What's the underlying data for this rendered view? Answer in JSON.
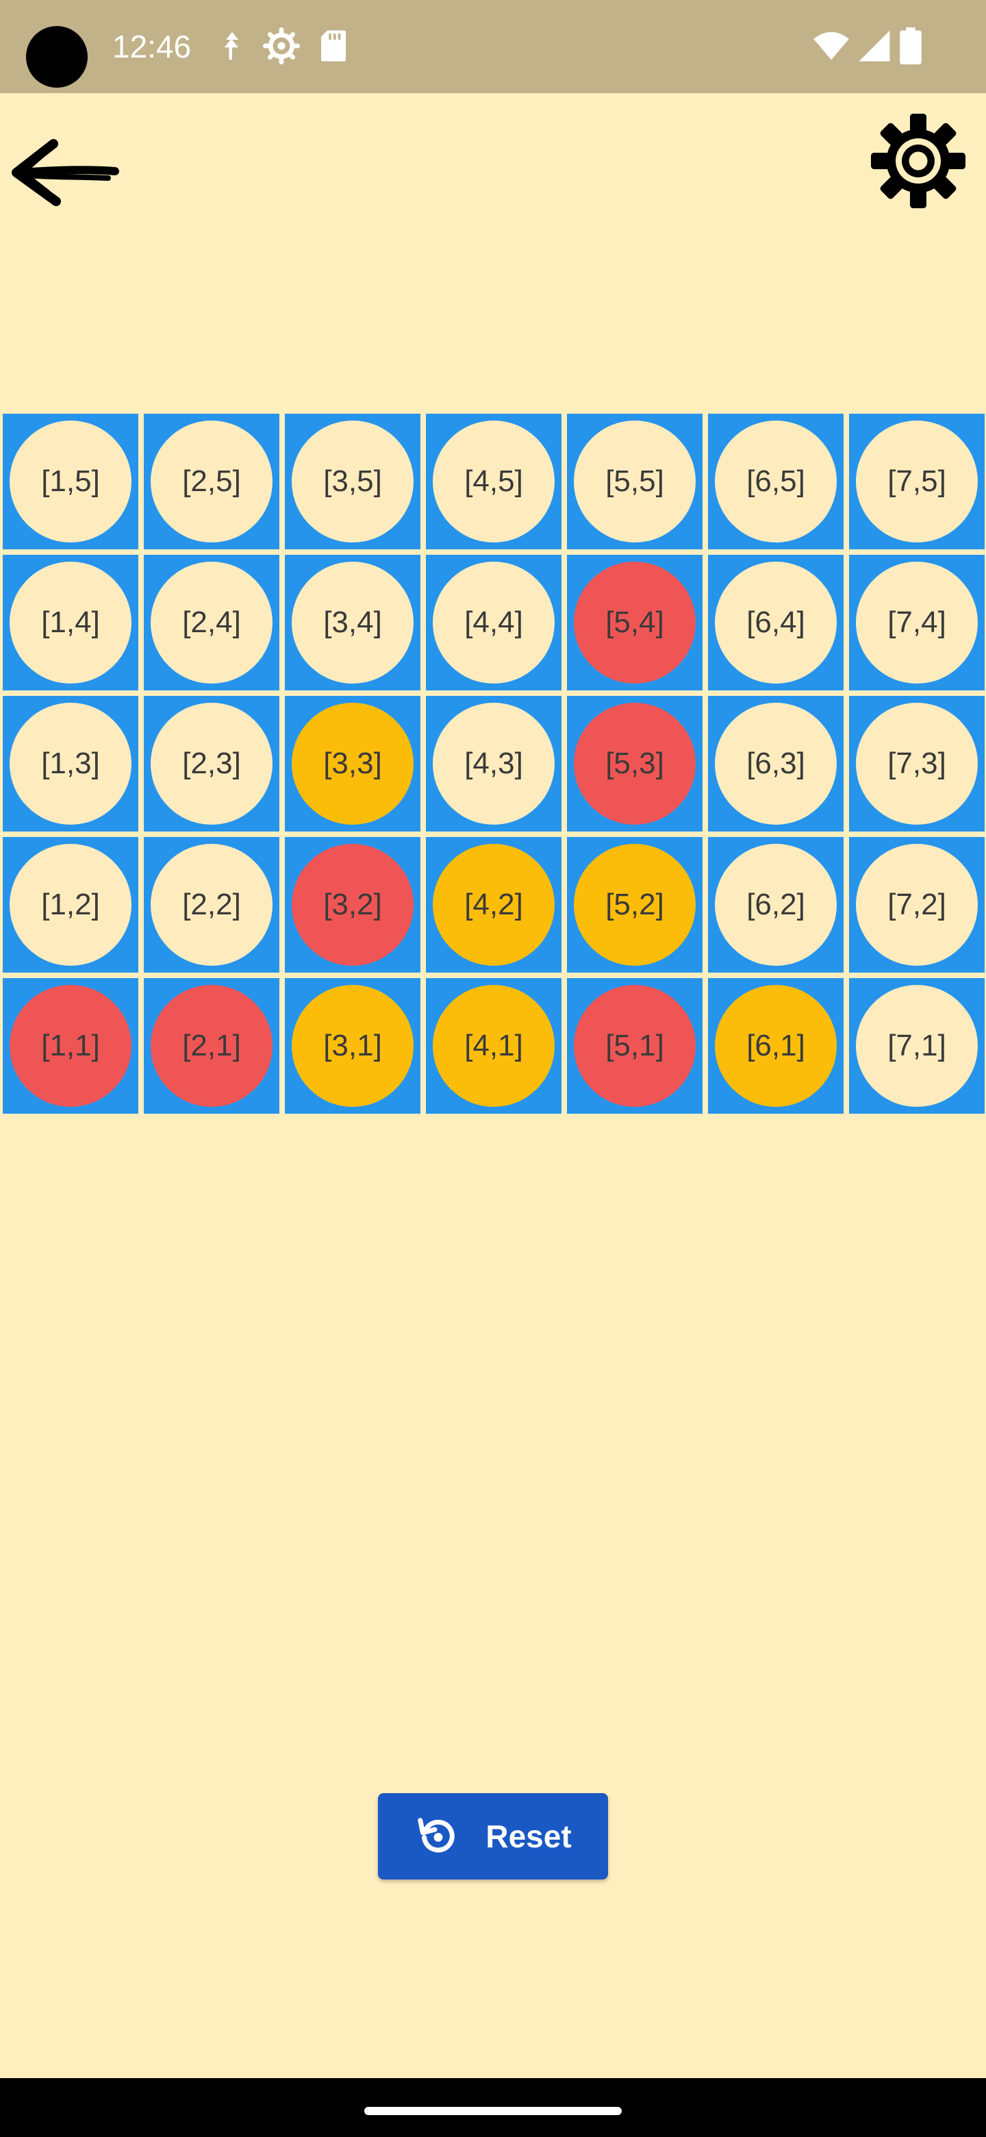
{
  "status_bar": {
    "time": "12:46",
    "left_icons": [
      "data-saver-icon",
      "settings-cog-icon",
      "sd-card-icon"
    ],
    "right_icons": [
      "wifi-icon",
      "cell-signal-icon",
      "battery-icon"
    ]
  },
  "header": {
    "back_icon": "back-arrow-icon",
    "settings_icon": "gear-icon"
  },
  "colors": {
    "background": "#ffefbf",
    "board": "#2694eb",
    "empty": "#ffecbe",
    "red": "#f05555",
    "yellow": "#fbbd0a",
    "reset_button": "#1a58c4"
  },
  "board": {
    "columns": 7,
    "rows": 5,
    "cells": [
      {
        "label": "[1,5]",
        "state": "empty"
      },
      {
        "label": "[2,5]",
        "state": "empty"
      },
      {
        "label": "[3,5]",
        "state": "empty"
      },
      {
        "label": "[4,5]",
        "state": "empty"
      },
      {
        "label": "[5,5]",
        "state": "empty"
      },
      {
        "label": "[6,5]",
        "state": "empty"
      },
      {
        "label": "[7,5]",
        "state": "empty"
      },
      {
        "label": "[1,4]",
        "state": "empty"
      },
      {
        "label": "[2,4]",
        "state": "empty"
      },
      {
        "label": "[3,4]",
        "state": "empty"
      },
      {
        "label": "[4,4]",
        "state": "empty"
      },
      {
        "label": "[5,4]",
        "state": "red"
      },
      {
        "label": "[6,4]",
        "state": "empty"
      },
      {
        "label": "[7,4]",
        "state": "empty"
      },
      {
        "label": "[1,3]",
        "state": "empty"
      },
      {
        "label": "[2,3]",
        "state": "empty"
      },
      {
        "label": "[3,3]",
        "state": "yellow"
      },
      {
        "label": "[4,3]",
        "state": "empty"
      },
      {
        "label": "[5,3]",
        "state": "red"
      },
      {
        "label": "[6,3]",
        "state": "empty"
      },
      {
        "label": "[7,3]",
        "state": "empty"
      },
      {
        "label": "[1,2]",
        "state": "empty"
      },
      {
        "label": "[2,2]",
        "state": "empty"
      },
      {
        "label": "[3,2]",
        "state": "red"
      },
      {
        "label": "[4,2]",
        "state": "yellow"
      },
      {
        "label": "[5,2]",
        "state": "yellow"
      },
      {
        "label": "[6,2]",
        "state": "empty"
      },
      {
        "label": "[7,2]",
        "state": "empty"
      },
      {
        "label": "[1,1]",
        "state": "red"
      },
      {
        "label": "[2,1]",
        "state": "red"
      },
      {
        "label": "[3,1]",
        "state": "yellow"
      },
      {
        "label": "[4,1]",
        "state": "yellow"
      },
      {
        "label": "[5,1]",
        "state": "red"
      },
      {
        "label": "[6,1]",
        "state": "yellow"
      },
      {
        "label": "[7,1]",
        "state": "empty"
      }
    ]
  },
  "reset": {
    "label": "Reset",
    "icon": "reset-icon"
  }
}
